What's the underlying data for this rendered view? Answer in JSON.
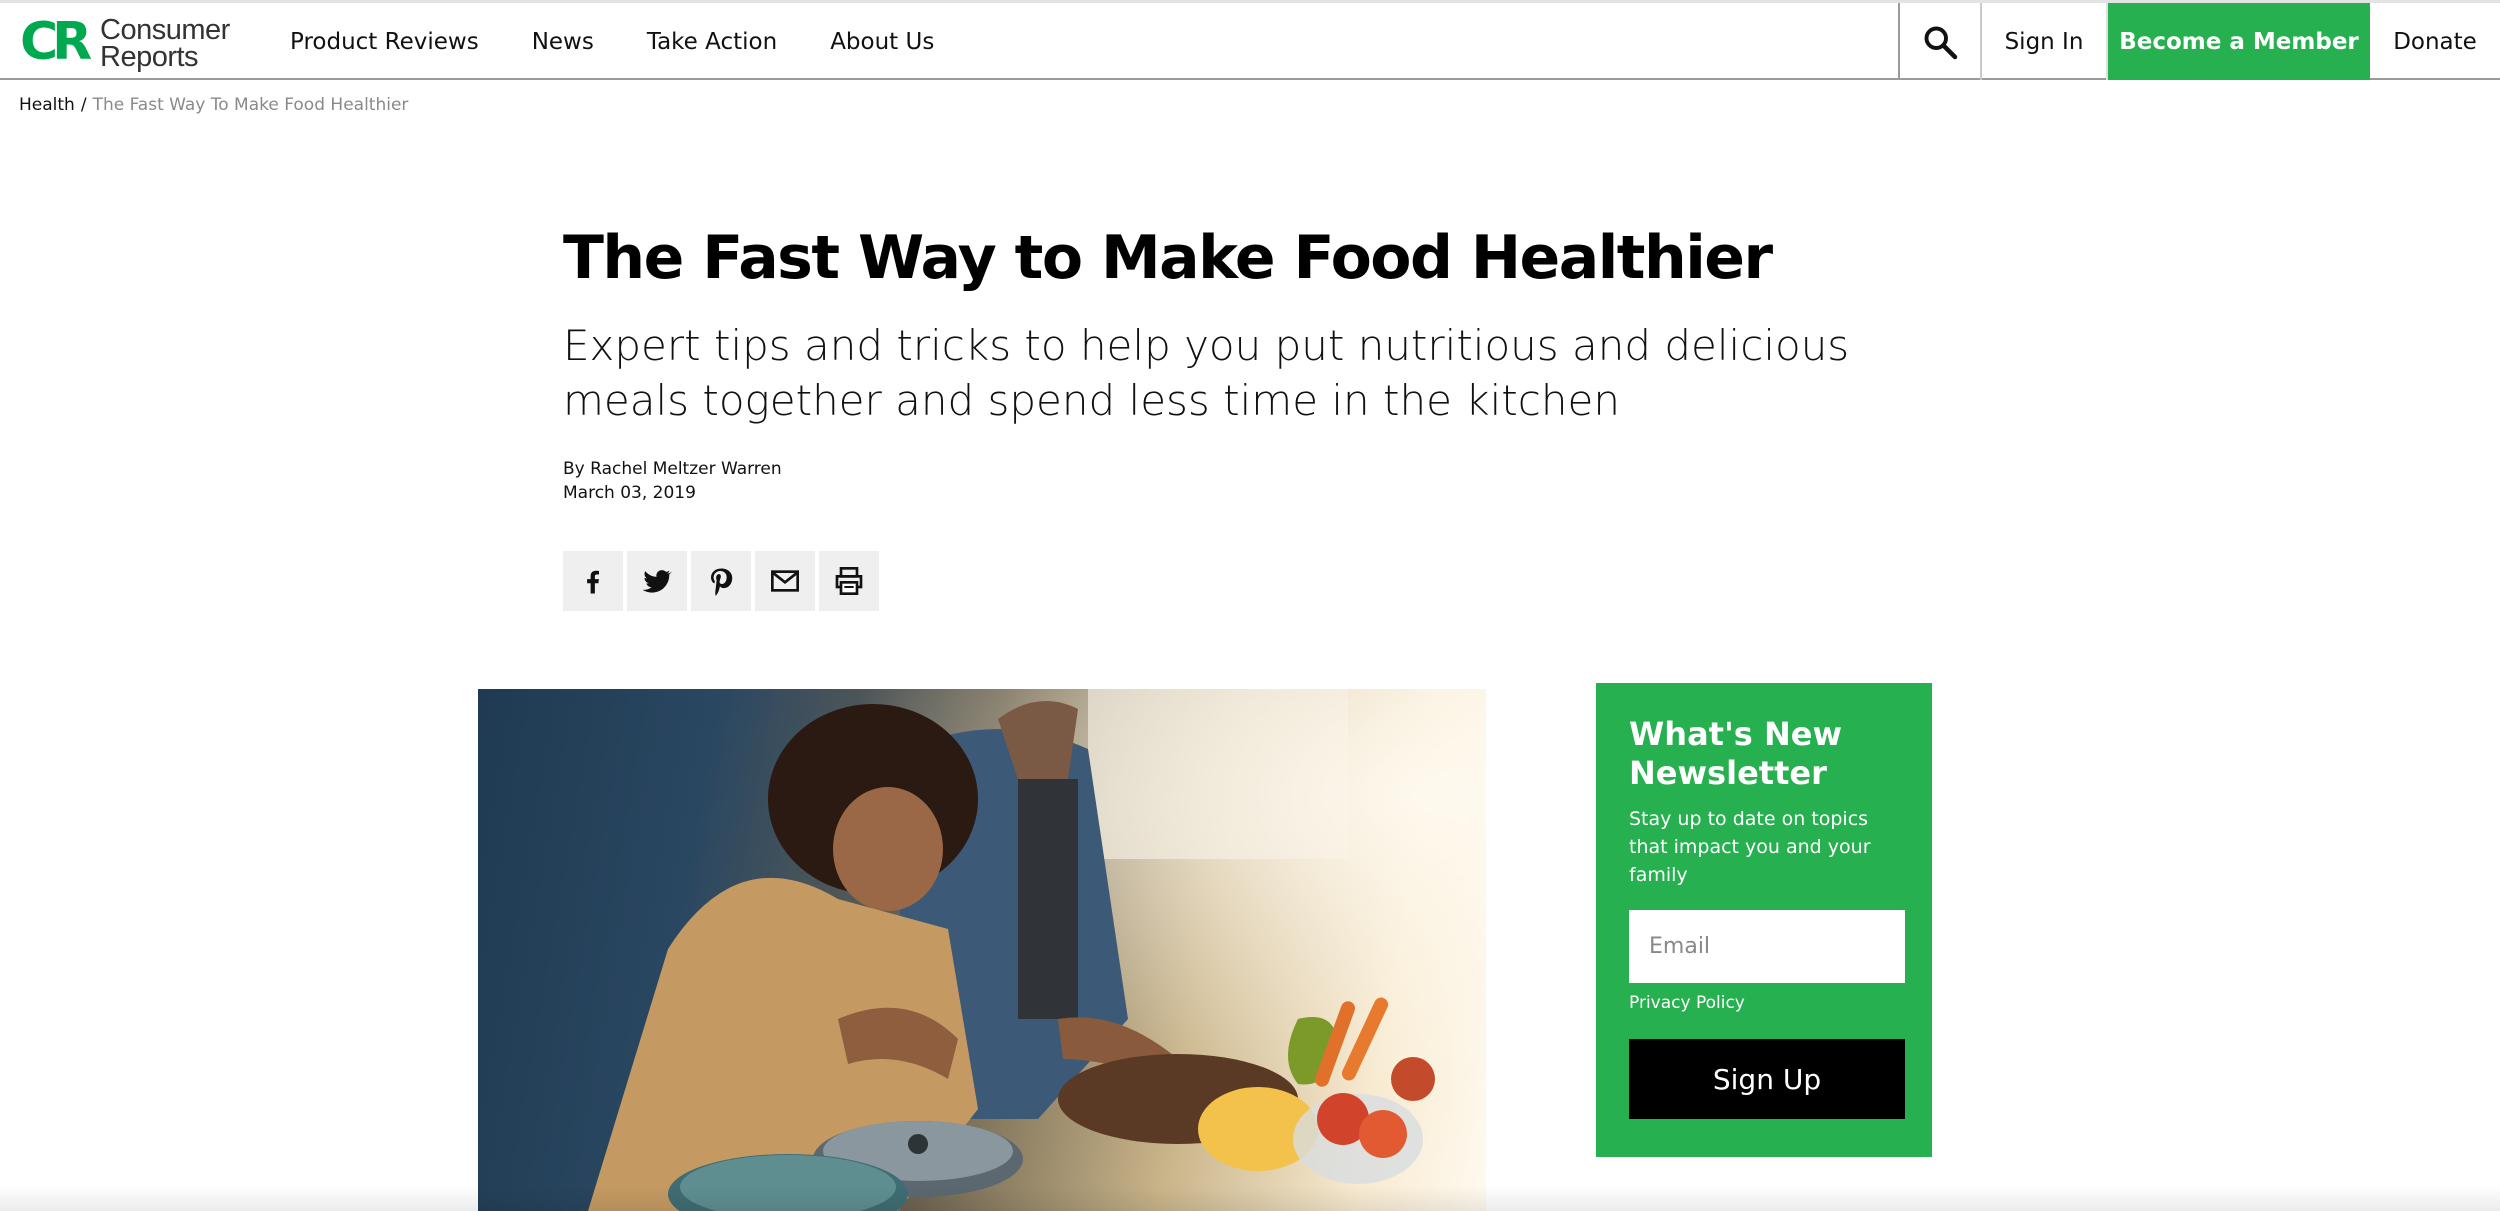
{
  "header": {
    "logo": {
      "mark": "CR",
      "line1": "Consumer",
      "line2": "Reports"
    },
    "nav": [
      "Product Reviews",
      "News",
      "Take Action",
      "About Us"
    ],
    "search_icon": "search-icon",
    "sign_in": "Sign In",
    "become_member": "Become a Member",
    "donate": "Donate"
  },
  "breadcrumb": {
    "root": "Health",
    "separator": "/",
    "current": "The Fast Way To Make Food Healthier"
  },
  "article": {
    "title": "The Fast Way to Make Food Healthier",
    "subtitle": "Expert tips and tricks to help you put nutritious and delicious meals together and spend less time in the kitchen",
    "author": "By Rachel Meltzer Warren",
    "date": "March 03, 2019",
    "share": [
      "facebook-icon",
      "twitter-icon",
      "pinterest-icon",
      "email-icon",
      "print-icon"
    ]
  },
  "newsletter": {
    "title": "What's New Newsletter",
    "description": "Stay up to date on topics that impact you and your family",
    "email_placeholder": "Email",
    "privacy": "Privacy Policy",
    "signup": "Sign Up"
  },
  "colors": {
    "brand_green": "#26b04f",
    "logo_green": "#00a94f",
    "signup_button": "#000000"
  }
}
